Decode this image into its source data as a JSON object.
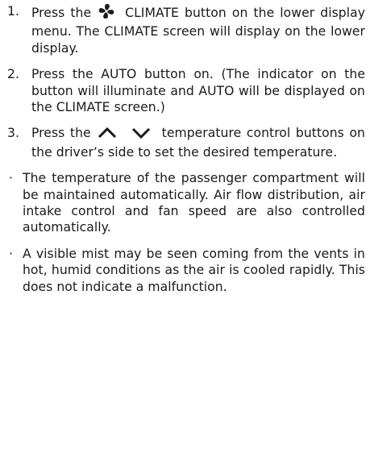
{
  "steps": [
    {
      "number": "1.",
      "pre": "Press the",
      "icon": "fan-icon",
      "post": "CLIMATE button on the lower display menu. The CLIMATE screen will display on the lower display."
    },
    {
      "number": "2.",
      "text": "Press the AUTO button on. (The indicator on the button will illuminate and AUTO will be displayed on the CLIMATE screen.)"
    },
    {
      "number": "3.",
      "pre": "Press the",
      "icon_up": "chevron-up-icon",
      "icon_down": "chevron-down-icon",
      "post": "temperature control buttons on the driver’s side to set the desired temperature."
    }
  ],
  "notes": [
    {
      "bullet": "·",
      "text": "The temperature of the passenger compartment will be maintained automatically. Air flow distribution, air intake control and fan speed are also controlled automatically."
    },
    {
      "bullet": "·",
      "text": "A visible mist may be seen coming from the vents in hot, humid conditions as the air is cooled rapidly. This does not indicate a malfunction."
    }
  ]
}
